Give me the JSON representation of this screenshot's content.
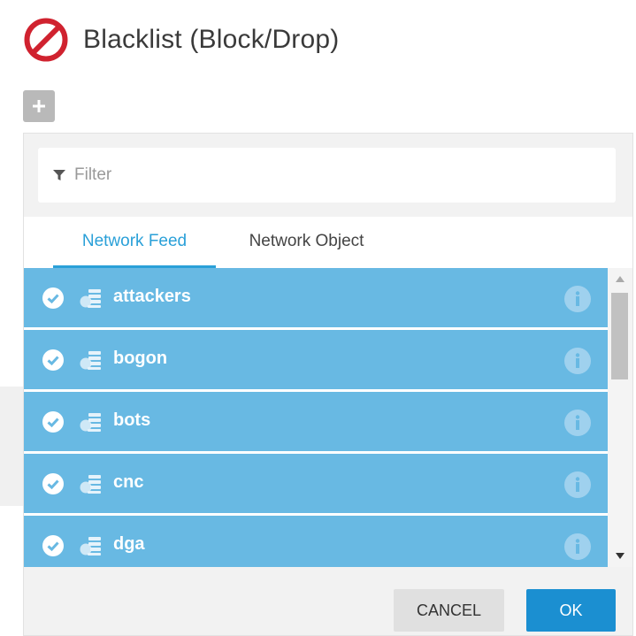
{
  "page": {
    "title": "Blacklist (Block/Drop)",
    "title_icon": "block-icon",
    "add_button_icon": "plus-icon"
  },
  "filter": {
    "placeholder": "Filter",
    "value": "",
    "icon": "filter-funnel-icon"
  },
  "tabs": [
    {
      "label": "Network Feed",
      "active": true
    },
    {
      "label": "Network Object",
      "active": false
    }
  ],
  "items": [
    {
      "label": "attackers",
      "selected": true
    },
    {
      "label": "bogon",
      "selected": true
    },
    {
      "label": "bots",
      "selected": true
    },
    {
      "label": "cnc",
      "selected": true
    },
    {
      "label": "dga",
      "selected": true
    }
  ],
  "buttons": {
    "cancel": "CANCEL",
    "ok": "OK"
  },
  "colors": {
    "accent": "#2aa0d8",
    "selected_row": "#68b9e3",
    "ok_button": "#1b8fd1",
    "block_icon_red": "#d0222f"
  }
}
